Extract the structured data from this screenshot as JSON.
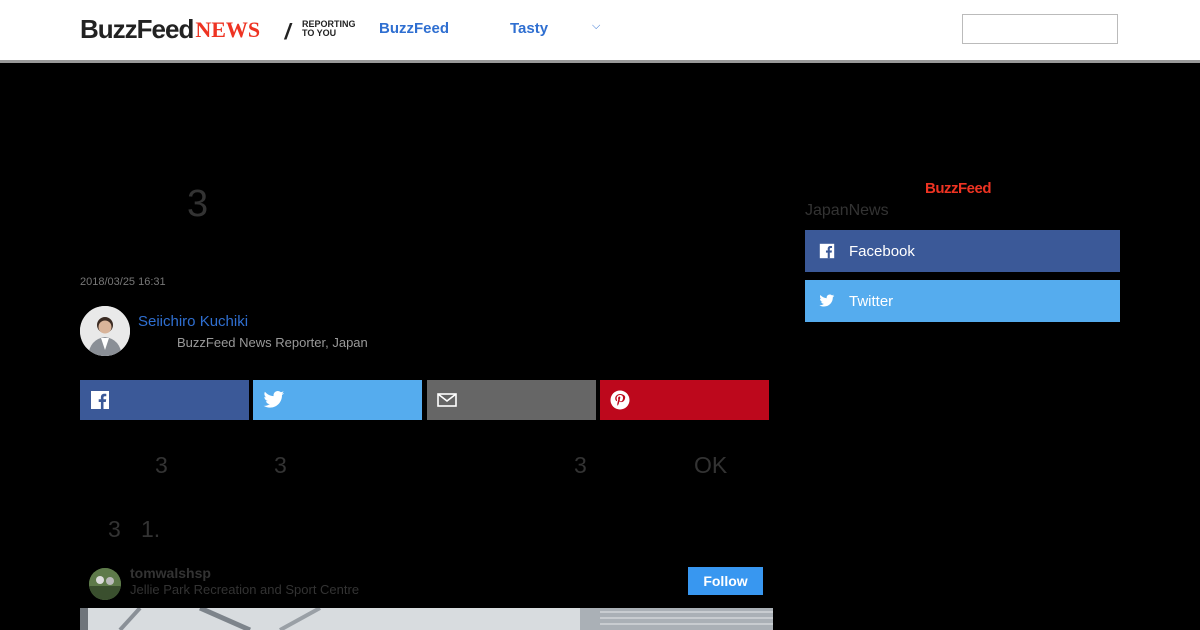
{
  "header": {
    "logo_brand": "BuzzFeed",
    "logo_news": "NEWS",
    "logo_tag": "REPORTING TO YOU",
    "nav": [
      {
        "label": "BuzzFeed"
      },
      {
        "label": "Tasty"
      }
    ],
    "search": {
      "value": "",
      "placeholder": ""
    }
  },
  "article": {
    "headline_fragment": "3",
    "timestamp": "2018/03/25 16:31",
    "author": {
      "name": "Seiichiro Kuchiki",
      "title": "BuzzFeed News Reporter, Japan"
    },
    "share_buttons": [
      "facebook-icon",
      "twitter-icon",
      "email-icon",
      "pinterest-icon"
    ],
    "body_fragments": [
      "3",
      "3",
      "3",
      "OK"
    ],
    "list_fragments": [
      "3",
      "1."
    ]
  },
  "instagram": {
    "username": "tomwalshsp",
    "location": "Jellie Park Recreation and Sport Centre",
    "follow_label": "Follow"
  },
  "sidebar": {
    "logo": "BuzzFeed",
    "label": "JapanNews",
    "buttons": [
      {
        "label": "Facebook",
        "icon": "facebook-icon"
      },
      {
        "label": "Twitter",
        "icon": "twitter-icon"
      }
    ]
  },
  "colors": {
    "facebook": "#3b5998",
    "twitter": "#55acee",
    "email": "#666666",
    "pinterest": "#bd081c",
    "link_blue": "#2f6fd1",
    "brand_red": "#ee3322",
    "instagram_follow": "#3897f0"
  }
}
